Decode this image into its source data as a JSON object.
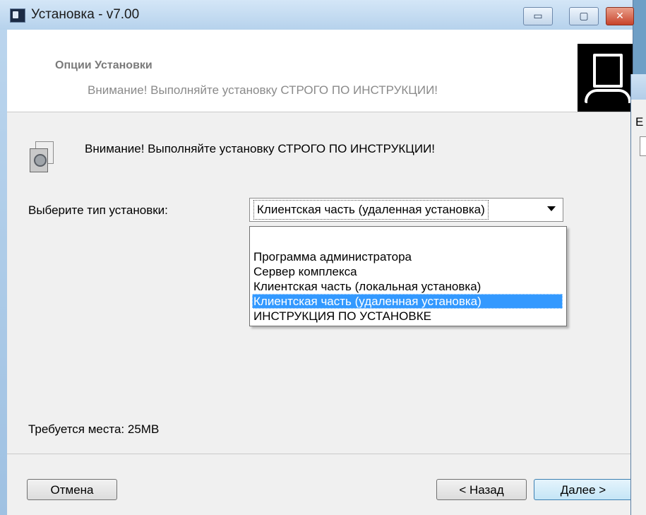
{
  "window": {
    "title": "Установка - v7.00",
    "minimize_glyph": "▭",
    "maximize_glyph": "▢",
    "close_glyph": "✕"
  },
  "header": {
    "title": "Опции Установки",
    "subtitle": "Внимание! Выполняйте установку СТРОГО ПО ИНСТРУКЦИИ!",
    "image_icon": "computer-setup-icon"
  },
  "body": {
    "warning_icon": "install-package-icon",
    "warning": "Внимание! Выполняйте установку СТРОГО ПО ИНСТРУКЦИИ!",
    "type_label": "Выберите тип установки:",
    "selected": "Клиентская часть (удаленная установка)",
    "options": [
      "Программа администратора",
      "Сервер комплекса",
      "Клиентская часть (локальная установка)",
      "Клиентская часть (удаленная установка)",
      "ИНСТРУКЦИЯ ПО УСТАНОВКЕ"
    ],
    "selected_index": 3,
    "space_required": "Требуется места: 25MB"
  },
  "buttons": {
    "cancel": "Отмена",
    "back": "< Назад",
    "next": "Далее >"
  },
  "background_window": {
    "visible_glyph": "E"
  },
  "colors": {
    "selection": "#3399ff",
    "close_button": "#c8432b",
    "title_gradient": "#b6d2ec"
  }
}
